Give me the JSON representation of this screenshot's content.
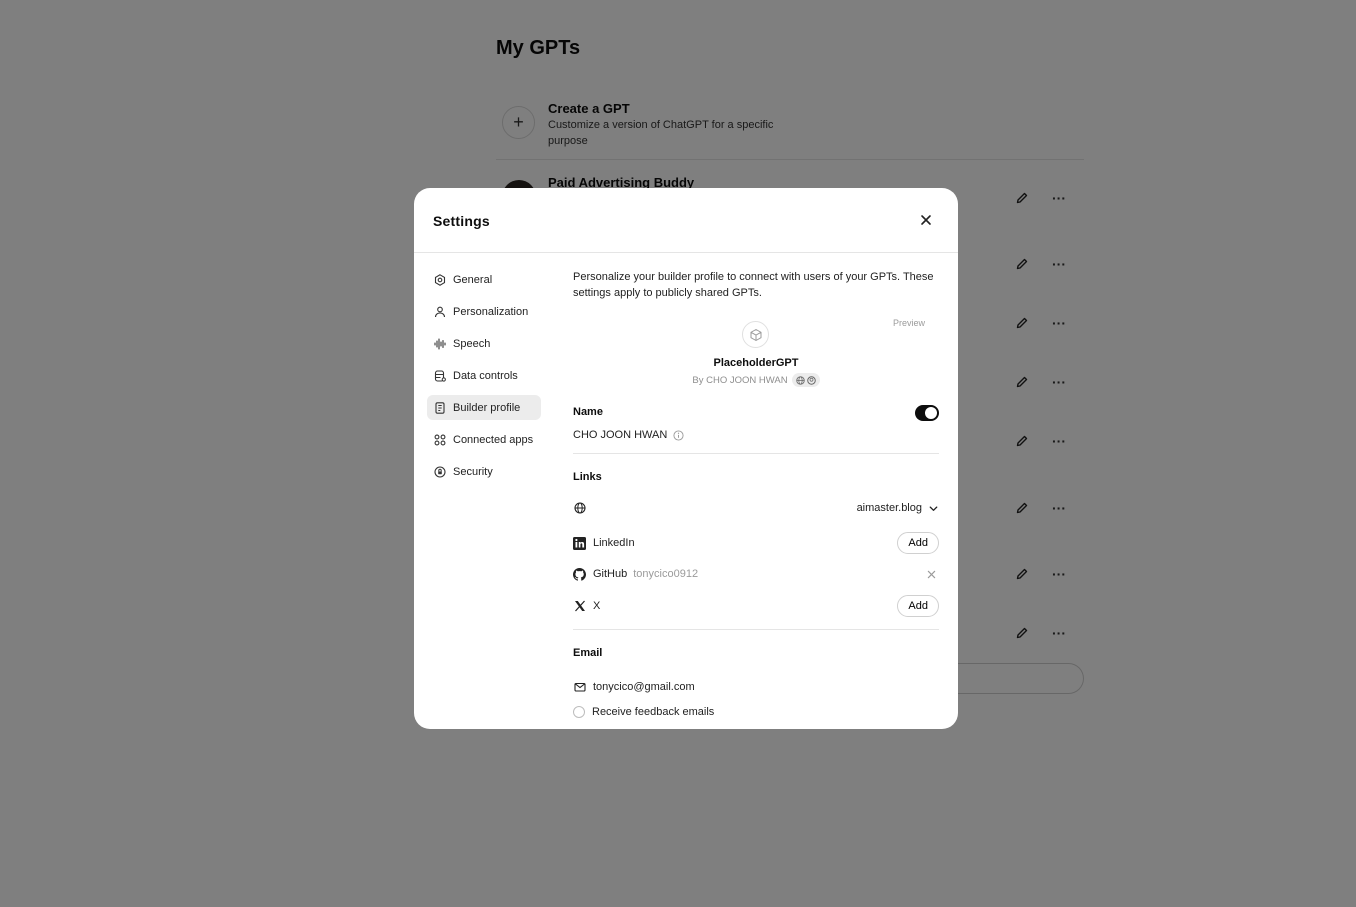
{
  "background": {
    "page_title": "My GPTs",
    "create": {
      "title": "Create a GPT",
      "description": "Customize a version of ChatGPT for a specific purpose",
      "icon": "plus-icon"
    },
    "first_gpt_name": "Paid Advertising Buddy",
    "row_more_label": "···"
  },
  "settings": {
    "title": "Settings",
    "close_icon": "close-icon",
    "nav": [
      {
        "label": "General",
        "icon": "gear-icon"
      },
      {
        "label": "Personalization",
        "icon": "person-icon"
      },
      {
        "label": "Speech",
        "icon": "waveform-icon"
      },
      {
        "label": "Data controls",
        "icon": "database-icon"
      },
      {
        "label": "Builder profile",
        "icon": "id-card-icon",
        "active": true
      },
      {
        "label": "Connected apps",
        "icon": "apps-grid-icon"
      },
      {
        "label": "Security",
        "icon": "shield-lock-icon"
      }
    ],
    "builder": {
      "intro": "Personalize your builder profile to connect with users of your GPTs. These settings apply to publicly shared GPTs.",
      "preview_label": "Preview",
      "preview_name": "PlaceholderGPT",
      "preview_by": "By CHO JOON HWAN",
      "name_label": "Name",
      "name_value": "CHO JOON HWAN",
      "name_toggle_on": true,
      "links_label": "Links",
      "website_domain": "aimaster.blog",
      "linkedin_label": "LinkedIn",
      "linkedin_action": "Add",
      "github_label": "GitHub",
      "github_user": "tonycico0912",
      "x_label": "X",
      "x_action": "Add",
      "email_label": "Email",
      "email_value": "tonycico@gmail.com",
      "feedback_label": "Receive feedback emails"
    }
  }
}
